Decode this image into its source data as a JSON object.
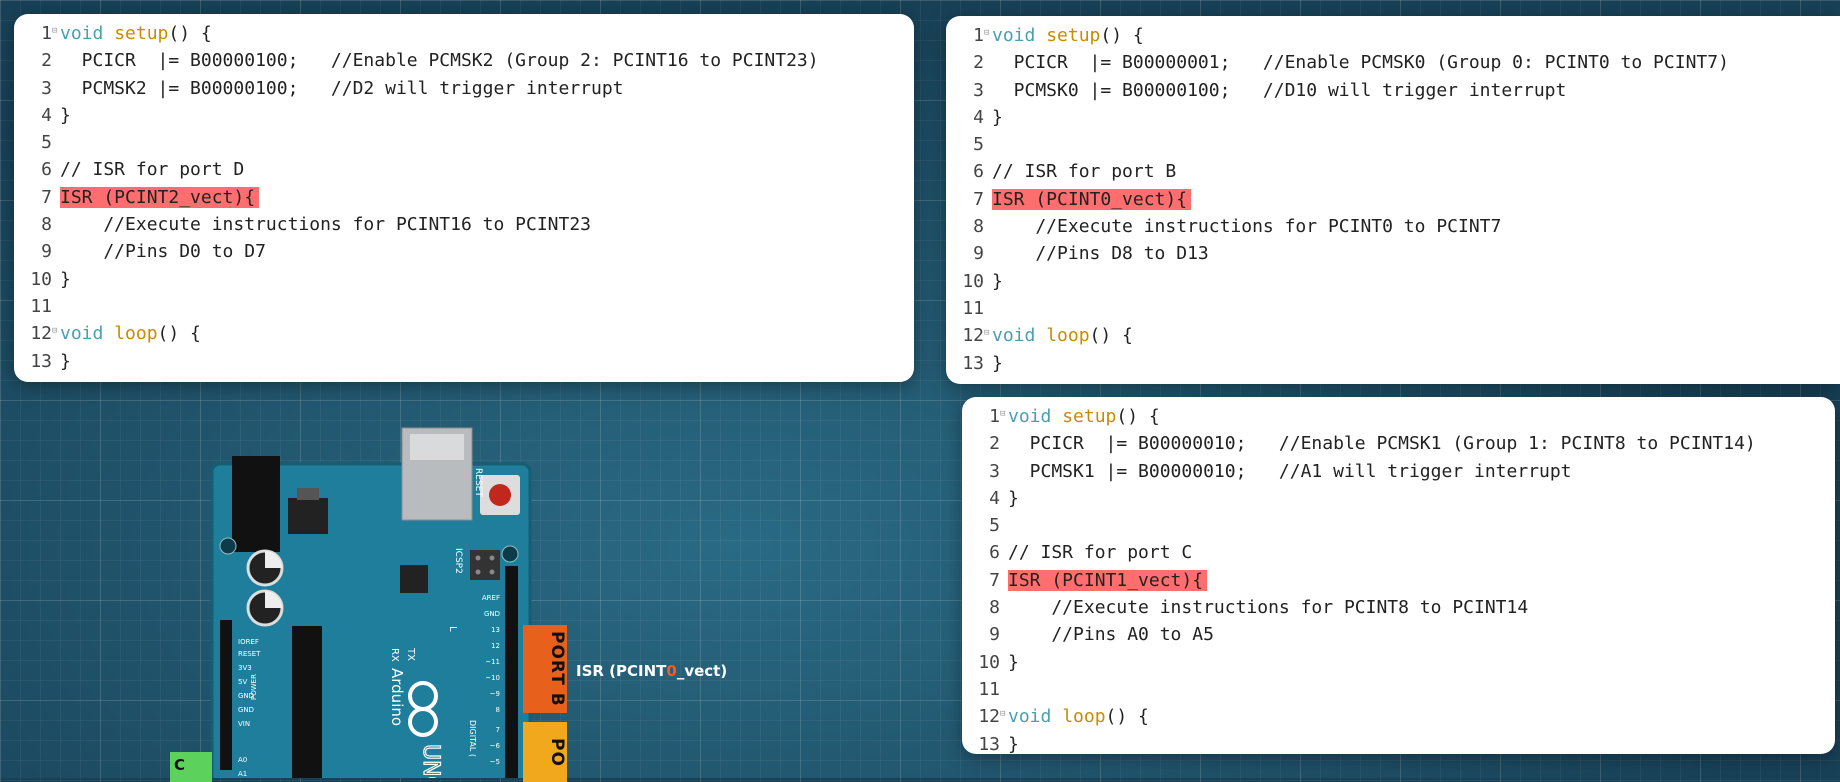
{
  "panels": {
    "a": {
      "lines": [
        {
          "n": "1",
          "fold": true,
          "parts": [
            [
              "kw",
              "void "
            ],
            [
              "fn",
              "setup"
            ],
            [
              "",
              "() {"
            ]
          ]
        },
        {
          "n": "2",
          "parts": [
            [
              "",
              "  PCICR  |= B00000100;   //Enable PCMSK2 (Group 2: PCINT16 to PCINT23)"
            ]
          ]
        },
        {
          "n": "3",
          "parts": [
            [
              "",
              "  PCMSK2 |= B00000100;   //D2 will trigger interrupt"
            ]
          ]
        },
        {
          "n": "4",
          "parts": [
            [
              "",
              "}"
            ]
          ]
        },
        {
          "n": "5",
          "parts": [
            [
              "",
              ""
            ]
          ]
        },
        {
          "n": "6",
          "parts": [
            [
              "",
              "// ISR for port D"
            ]
          ]
        },
        {
          "n": "7",
          "parts": [
            [
              "hl",
              "ISR (PCINT2_vect){"
            ]
          ]
        },
        {
          "n": "8",
          "parts": [
            [
              "",
              "    //Execute instructions for PCINT16 to PCINT23"
            ]
          ]
        },
        {
          "n": "9",
          "parts": [
            [
              "",
              "    //Pins D0 to D7"
            ]
          ]
        },
        {
          "n": "10",
          "parts": [
            [
              "",
              "}"
            ]
          ]
        },
        {
          "n": "11",
          "parts": [
            [
              "",
              ""
            ]
          ]
        },
        {
          "n": "12",
          "fold": true,
          "parts": [
            [
              "kw",
              "void "
            ],
            [
              "fn",
              "loop"
            ],
            [
              "",
              "() {"
            ]
          ]
        },
        {
          "n": "13",
          "parts": [
            [
              "",
              "}"
            ]
          ]
        }
      ]
    },
    "b": {
      "lines": [
        {
          "n": "1",
          "fold": true,
          "parts": [
            [
              "kw",
              "void "
            ],
            [
              "fn",
              "setup"
            ],
            [
              "",
              "() {"
            ]
          ]
        },
        {
          "n": "2",
          "parts": [
            [
              "",
              "  PCICR  |= B00000001;   //Enable PCMSK0 (Group 0: PCINT0 to PCINT7)"
            ]
          ]
        },
        {
          "n": "3",
          "parts": [
            [
              "",
              "  PCMSK0 |= B00000100;   //D10 will trigger interrupt"
            ]
          ]
        },
        {
          "n": "4",
          "parts": [
            [
              "",
              "}"
            ]
          ]
        },
        {
          "n": "5",
          "parts": [
            [
              "",
              ""
            ]
          ]
        },
        {
          "n": "6",
          "parts": [
            [
              "",
              "// ISR for port B"
            ]
          ]
        },
        {
          "n": "7",
          "parts": [
            [
              "hl",
              "ISR (PCINT0_vect){"
            ]
          ]
        },
        {
          "n": "8",
          "parts": [
            [
              "",
              "    //Execute instructions for PCINT0 to PCINT7"
            ]
          ]
        },
        {
          "n": "9",
          "parts": [
            [
              "",
              "    //Pins D8 to D13"
            ]
          ]
        },
        {
          "n": "10",
          "parts": [
            [
              "",
              "}"
            ]
          ]
        },
        {
          "n": "11",
          "parts": [
            [
              "",
              ""
            ]
          ]
        },
        {
          "n": "12",
          "fold": true,
          "parts": [
            [
              "kw",
              "void "
            ],
            [
              "fn",
              "loop"
            ],
            [
              "",
              "() {"
            ]
          ]
        },
        {
          "n": "13",
          "parts": [
            [
              "",
              "}"
            ]
          ]
        }
      ]
    },
    "c": {
      "lines": [
        {
          "n": "1",
          "fold": true,
          "parts": [
            [
              "kw",
              "void "
            ],
            [
              "fn",
              "setup"
            ],
            [
              "",
              "() {"
            ]
          ]
        },
        {
          "n": "2",
          "parts": [
            [
              "",
              "  PCICR  |= B00000010;   //Enable PCMSK1 (Group 1: PCINT8 to PCINT14)"
            ]
          ]
        },
        {
          "n": "3",
          "parts": [
            [
              "",
              "  PCMSK1 |= B00000010;   //A1 will trigger interrupt"
            ]
          ]
        },
        {
          "n": "4",
          "parts": [
            [
              "",
              "}"
            ]
          ]
        },
        {
          "n": "5",
          "parts": [
            [
              "",
              ""
            ]
          ]
        },
        {
          "n": "6",
          "parts": [
            [
              "",
              "// ISR for port C"
            ]
          ]
        },
        {
          "n": "7",
          "parts": [
            [
              "hl",
              "ISR (PCINT1_vect){"
            ]
          ]
        },
        {
          "n": "8",
          "parts": [
            [
              "",
              "    //Execute instructions for PCINT8 to PCINT14"
            ]
          ]
        },
        {
          "n": "9",
          "parts": [
            [
              "",
              "    //Pins A0 to A5"
            ]
          ]
        },
        {
          "n": "10",
          "parts": [
            [
              "",
              "}"
            ]
          ]
        },
        {
          "n": "11",
          "parts": [
            [
              "",
              ""
            ]
          ]
        },
        {
          "n": "12",
          "fold": true,
          "parts": [
            [
              "kw",
              "void "
            ],
            [
              "fn",
              "loop"
            ],
            [
              "",
              "() {"
            ]
          ]
        },
        {
          "n": "13",
          "parts": [
            [
              "",
              "}"
            ]
          ]
        }
      ]
    }
  },
  "board": {
    "port_b_label": "PORT B",
    "port_d_label": "PO",
    "green_label": "C",
    "callout_pre": "ISR (PCINT",
    "callout_num": "0",
    "callout_post": "_vect)",
    "brand": "Arduino",
    "model": "UNO",
    "reset_label": "RESET",
    "icsp_label": "ICSP2",
    "tx_label": "TX",
    "rx_label": "RX",
    "l_label": "L",
    "power_labels": [
      "IOREF",
      "RESET",
      "3V3",
      "5V",
      "GND",
      "GND",
      "VIN"
    ],
    "power_title": "POWER",
    "digital_labels": [
      "AREF",
      "GND",
      "13",
      "12",
      "~11",
      "~10",
      "~9",
      "8",
      "7",
      "~6",
      "~5"
    ],
    "digital_title": "DIGITAL (",
    "analog_labels": [
      "A0",
      "A1"
    ]
  },
  "colors": {
    "highlight": "#ff6e6e",
    "keyword": "#4a9fb0",
    "function": "#c98b00",
    "port_b": "#e8611c",
    "port_d": "#f2a81d",
    "board": "#1e7e9c"
  }
}
